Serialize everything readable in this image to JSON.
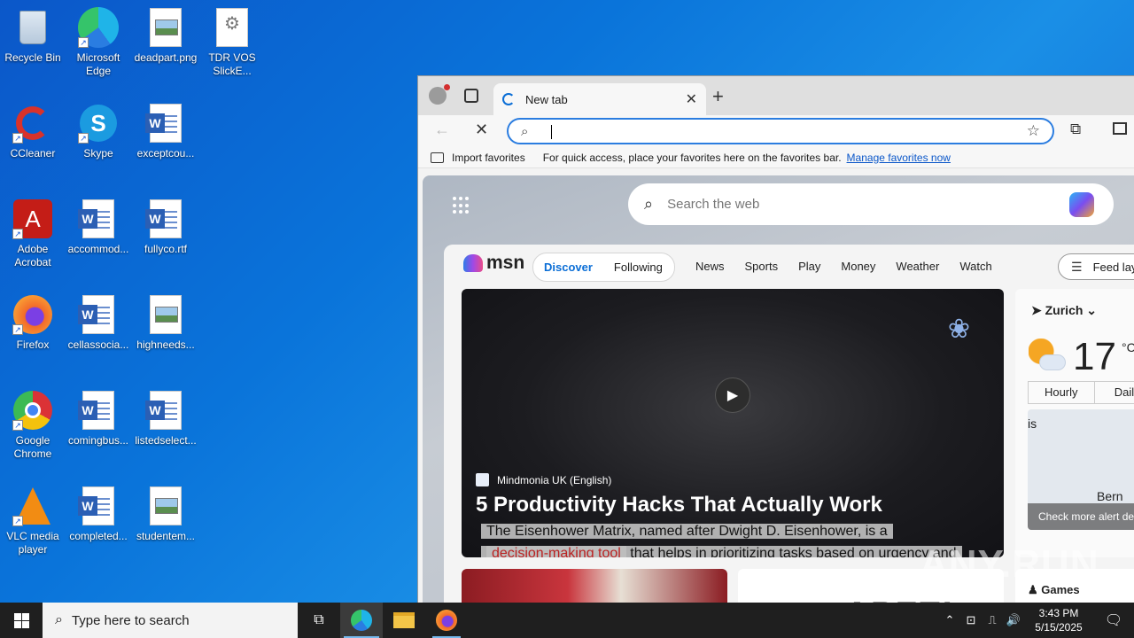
{
  "desktop": {
    "icons": [
      {
        "label": "Recycle Bin",
        "icon": "recycle-bin-icon"
      },
      {
        "label": "Microsoft Edge",
        "icon": "edge-icon"
      },
      {
        "label": "deadpart.png",
        "icon": "image-file-icon"
      },
      {
        "label": "TDR VOS SlickE...",
        "icon": "settings-file-icon"
      },
      {
        "label": "CCleaner",
        "icon": "ccleaner-icon"
      },
      {
        "label": "Skype",
        "icon": "skype-icon"
      },
      {
        "label": "exceptcou...",
        "icon": "word-doc-icon"
      },
      {
        "label": "Adobe Acrobat",
        "icon": "acrobat-icon"
      },
      {
        "label": "accommod...",
        "icon": "word-doc-icon"
      },
      {
        "label": "fullyco.rtf",
        "icon": "word-doc-icon"
      },
      {
        "label": "Firefox",
        "icon": "firefox-icon"
      },
      {
        "label": "cellassocia...",
        "icon": "word-doc-icon"
      },
      {
        "label": "highneeds...",
        "icon": "image-file-icon"
      },
      {
        "label": "Google Chrome",
        "icon": "chrome-icon"
      },
      {
        "label": "comingbus...",
        "icon": "word-doc-icon"
      },
      {
        "label": "listedselect...",
        "icon": "word-doc-icon"
      },
      {
        "label": "VLC media player",
        "icon": "vlc-icon"
      },
      {
        "label": "completed...",
        "icon": "word-doc-icon"
      },
      {
        "label": "studentem...",
        "icon": "image-file-icon"
      }
    ]
  },
  "browser": {
    "tab_title": "New tab",
    "address_value": "",
    "favbar": {
      "import_label": "Import favorites",
      "message": "For quick access, place your favorites here on the favorites bar.",
      "manage_link": "Manage favorites now"
    },
    "ntp": {
      "search_placeholder": "Search the web",
      "msn_logo": "msn",
      "tabs": [
        "Discover",
        "Following"
      ],
      "nav": [
        "News",
        "Sports",
        "Play",
        "Money",
        "Weather",
        "Watch"
      ],
      "feed_layout": "Feed layout",
      "hero": {
        "source": "Mindmonia UK (English)",
        "headline": "5 Productivity Hacks That Actually Work",
        "subtitle_line1": "The Eisenhower Matrix, named after Dwight D. Eisenhower, is a",
        "subtitle_line2_red": "decision-making tool",
        "subtitle_line2_rest": " that helps in prioritizing tasks based on urgency and"
      },
      "weather": {
        "city": "Zurich",
        "temp": "17",
        "unit": "°C",
        "tab_hourly": "Hourly",
        "tab_daily": "Daily",
        "map_label_1": "is",
        "map_label_2": "Bern",
        "alert_text": "Check more alert details"
      },
      "games_label": "Games",
      "apfel_text": "APFEL"
    }
  },
  "taskbar": {
    "search_placeholder": "Type here to search",
    "time": "3:43 PM",
    "date": "5/15/2025"
  },
  "watermark": "ANY.RUN"
}
